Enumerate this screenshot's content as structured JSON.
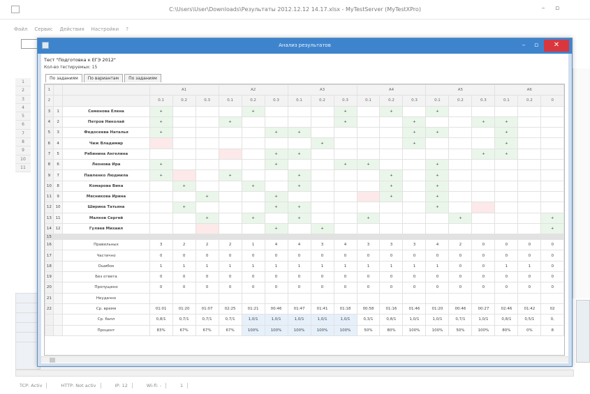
{
  "main_window": {
    "title": "C:\\Users\\User\\Downloads\\Результаты 2012.12.12 14.17.xlsx - MyTestServer (MyTestXPro)",
    "menu": [
      "Файл",
      "Сервис",
      "Действия",
      "Настройки",
      "?"
    ],
    "status": [
      "TCP: Activ",
      "HTTP: Not activ",
      "IP: 12",
      "Wi-fi: -",
      "1"
    ]
  },
  "results_dialog": {
    "title": "Анализ результатов",
    "test_name": "Тест \"Подготовка к ЕГЭ 2012\"",
    "question_count": "Кол-во тестируемых: 15",
    "tabs": [
      "По заданиям",
      "По вариантам",
      "По заданиям"
    ],
    "task_groups": [
      "A1",
      "A2",
      "A3",
      "A4",
      "A5",
      "A6"
    ],
    "subtasks": [
      "0.1",
      "0.2",
      "0.3",
      "0.1",
      "0.2",
      "0.3",
      "0.1",
      "0.2",
      "0.3",
      "0.1",
      "0.2",
      "0.3",
      "0.1",
      "0.2",
      "0.3",
      "0.1",
      "0.2",
      "0"
    ],
    "row_numbers": [
      "1",
      "2",
      "3",
      "4",
      "5",
      "6",
      "7",
      "8",
      "9",
      "10",
      "11",
      "12",
      "13",
      "14",
      "15",
      "16",
      "17",
      "18",
      "19",
      "20",
      "21",
      "22"
    ],
    "index_numbers": [
      "1",
      "2",
      "3",
      "4",
      "5",
      "6",
      "7",
      "8",
      "9",
      "10",
      "11",
      "12"
    ],
    "students": [
      {
        "name": "Семенова Елена",
        "marks": {
          "0": "+",
          "4": "+",
          "8": "+",
          "10": "+",
          "12": "+"
        }
      },
      {
        "name": "Петров Николай",
        "marks": {
          "0": "+",
          "3": "+",
          "8": "+",
          "11": "+",
          "14": "+",
          "15": "+"
        }
      },
      {
        "name": "Федосеева Наталья",
        "marks": {
          "0": "+",
          "5": "+",
          "6": "+",
          "11": "+",
          "12": "+",
          "15": "+"
        }
      },
      {
        "name": "Чиж Владимир",
        "marks": {
          "7": "+",
          "11": "+",
          "15": "+"
        }
      },
      {
        "name": "Рябинина Ангелина",
        "marks": {
          "5": "+",
          "6": "+",
          "14": "+",
          "15": "+"
        }
      },
      {
        "name": "Леонова Ира",
        "marks": {
          "0": "+",
          "5": "+",
          "8": "+",
          "9": "+",
          "12": "+"
        }
      },
      {
        "name": "Павленко Людмила",
        "marks": {
          "0": "+",
          "3": "+",
          "6": "+",
          "10": "+",
          "12": "+"
        }
      },
      {
        "name": "Комарова Вика",
        "marks": {
          "1": "+",
          "4": "+",
          "6": "+",
          "10": "+",
          "12": "+"
        }
      },
      {
        "name": "Мясникова Ирина",
        "marks": {
          "2": "+",
          "5": "+",
          "10": "+",
          "12": "+"
        }
      },
      {
        "name": "Ширина Татьяна",
        "marks": {
          "1": "+",
          "5": "+",
          "6": "+",
          "12": "+"
        }
      },
      {
        "name": "Малков Сергей",
        "marks": {
          "2": "+",
          "4": "+",
          "6": "+",
          "9": "+",
          "13": "+",
          "17": "+"
        }
      },
      {
        "name": "Гуляев Михаил",
        "marks": {
          "5": "+",
          "7": "+",
          "17": "+"
        }
      }
    ],
    "summary_rows": [
      {
        "label": "Правильных",
        "values": [
          "3",
          "2",
          "2",
          "2",
          "1",
          "4",
          "4",
          "3",
          "4",
          "3",
          "3",
          "3",
          "4",
          "2",
          "0",
          "0",
          "0",
          "0"
        ]
      },
      {
        "label": "Частично",
        "values": [
          "0",
          "0",
          "0",
          "0",
          "0",
          "0",
          "0",
          "0",
          "0",
          "0",
          "0",
          "0",
          "0",
          "0",
          "0",
          "0",
          "0",
          "0"
        ]
      },
      {
        "label": "Ошибок",
        "values": [
          "1",
          "1",
          "1",
          "1",
          "1",
          "1",
          "1",
          "1",
          "1",
          "1",
          "1",
          "1",
          "1",
          "0",
          "0",
          "1",
          "1",
          "0"
        ]
      },
      {
        "label": "Без ответа",
        "values": [
          "0",
          "0",
          "0",
          "0",
          "0",
          "0",
          "0",
          "0",
          "0",
          "0",
          "0",
          "0",
          "0",
          "0",
          "0",
          "0",
          "0",
          "0"
        ]
      },
      {
        "label": "Пропущено",
        "values": [
          "0",
          "0",
          "0",
          "0",
          "0",
          "0",
          "0",
          "0",
          "0",
          "0",
          "0",
          "0",
          "0",
          "0",
          "0",
          "0",
          "0",
          "0"
        ]
      },
      {
        "label": "Неудачно",
        "values": [
          "",
          "",
          "",
          "",
          "",
          "",
          "",
          "",
          "",
          "",
          "",
          "",
          "",
          "",
          "",
          "",
          "",
          ""
        ]
      },
      {
        "label": "Ср. время",
        "values": [
          "01:01",
          "01:20",
          "01:07",
          "02:25",
          "01:21",
          "00:46",
          "01:47",
          "01:41",
          "01:18",
          "00:58",
          "01:16",
          "01:46",
          "01:20",
          "00:46",
          "00:27",
          "02:46",
          "01:42",
          "02"
        ]
      },
      {
        "label": "Ср. балл",
        "values": [
          "0,8/1",
          "0,7/1",
          "0,7/1",
          "0,7/1",
          "1,0/1",
          "1,0/1",
          "1,0/1",
          "1,0/1",
          "1,0/1",
          "0,3/1",
          "0,8/1",
          "1,0/1",
          "1,0/1",
          "0,7/1",
          "1,0/1",
          "0,8/1",
          "0,5/1",
          "0,"
        ]
      },
      {
        "label": "Процент",
        "values": [
          "83%",
          "67%",
          "67%",
          "67%",
          "100%",
          "100%",
          "100%",
          "100%",
          "100%",
          "50%",
          "80%",
          "100%",
          "100%",
          "50%",
          "100%",
          "80%",
          "0%",
          "8"
        ]
      }
    ]
  }
}
